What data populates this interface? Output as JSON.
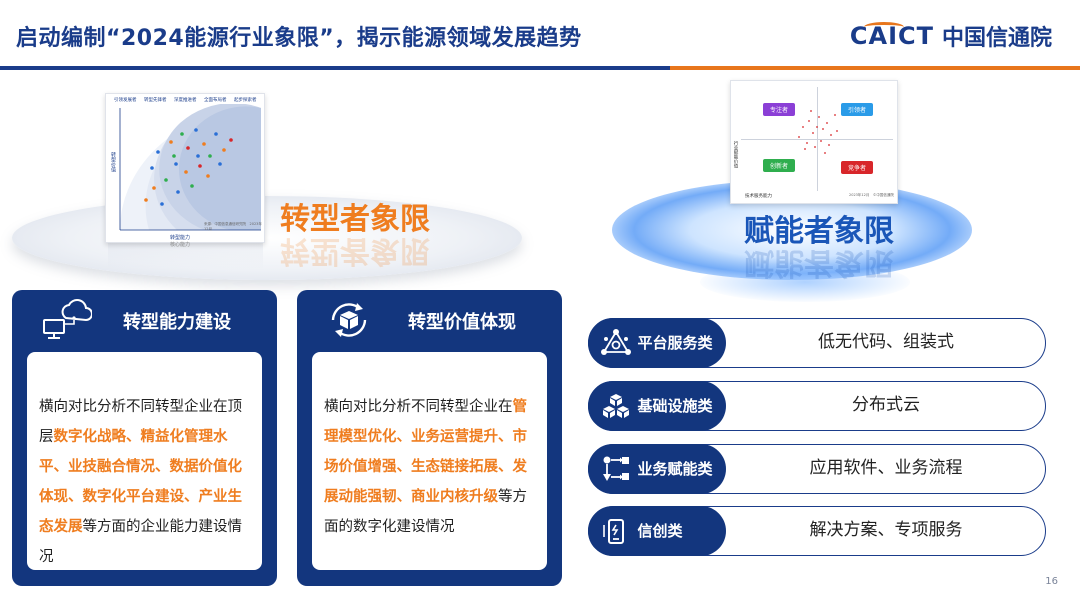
{
  "header": {
    "title": "启动编制“2024能源行业象限”，揭示能源领域发展趋势",
    "logo_en": "CAICT",
    "logo_cn": "中国信通院"
  },
  "left_visual": {
    "title": "转型者象限",
    "doc_top_labels": [
      "引领发展者",
      "转型先锋者",
      "深度推进者",
      "全面布局者",
      "起步探索者"
    ],
    "doc_ylabel": "转型价值",
    "doc_xlabel": "转型能力",
    "doc_xsublabel": "核心能力",
    "doc_note": "来源：中国信息通信研究院　2023年12月"
  },
  "right_visual": {
    "title": "赋能者象限",
    "quadrants": [
      {
        "label": "专注者",
        "color": "#8b3fd6"
      },
      {
        "label": "引领者",
        "color": "#2a9be8"
      },
      {
        "label": "创新者",
        "color": "#2fae4e"
      },
      {
        "label": "竞争者",
        "color": "#d8262a"
      }
    ],
    "ylabel": "行业赋能价值",
    "xlabel": "技术服务能力",
    "note": "2023年12月　©中国信通院"
  },
  "cards": [
    {
      "heading": "转型能力建设",
      "icon": "cloud-computer-icon",
      "body_pre": "横向对比分析不同转型企业在顶层",
      "body_highlight": "数字化战略、精益化管理水平、业技融合情况、数据价值化体现、数字化平台建设、产业生态发展",
      "body_post": "等方面的企业能力建设情况"
    },
    {
      "heading": "转型价值体现",
      "icon": "box-cycle-icon",
      "body_pre": "横向对比分析不同转型企业在",
      "body_highlight": "管理模型优化、业务运营提升、市场价值增强、生态链接拓展、发展动能强韧、商业内核升级",
      "body_post": "等方面的数字化建设情况"
    }
  ],
  "rows": [
    {
      "tag": "平台服务类",
      "value": "低无代码、组装式",
      "icon": "network-icon"
    },
    {
      "tag": "基础设施类",
      "value": "分布式云",
      "icon": "cubes-icon"
    },
    {
      "tag": "业务赋能类",
      "value": "应用软件、业务流程",
      "icon": "workflow-icon"
    },
    {
      "tag": "信创类",
      "value": "解决方案、专项服务",
      "icon": "phone-device-icon"
    }
  ],
  "page_number": "16",
  "colors": {
    "primary": "#13367e",
    "accent": "#ef7d1f",
    "blue_title": "#1a56b8"
  }
}
